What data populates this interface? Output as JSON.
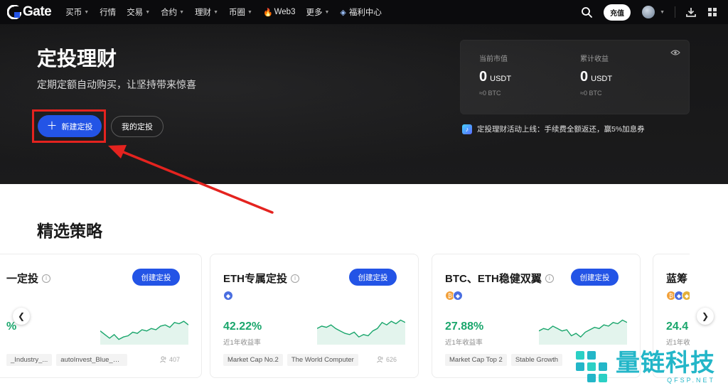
{
  "nav": {
    "logo_text": "Gate",
    "items": [
      {
        "label": "买币",
        "caret": true
      },
      {
        "label": "行情",
        "caret": false
      },
      {
        "label": "交易",
        "caret": true
      },
      {
        "label": "合约",
        "caret": true
      },
      {
        "label": "理财",
        "caret": true
      },
      {
        "label": "币圈",
        "caret": true
      },
      {
        "label": "Web3",
        "caret": false
      },
      {
        "label": "更多",
        "caret": true
      },
      {
        "label": "福利中心",
        "caret": false
      }
    ],
    "deposit_label": "充值"
  },
  "hero": {
    "title": "定投理财",
    "subtitle": "定期定额自动购买，让坚持带来惊喜",
    "new_plan_label": "新建定投",
    "my_plans_label": "我的定投",
    "assets": {
      "current_label": "当前市值",
      "current_value": "0",
      "current_unit": "USDT",
      "current_btc": "≈0 BTC",
      "profit_label": "累计收益",
      "profit_value": "0",
      "profit_unit": "USDT",
      "profit_btc": "≈0 BTC"
    },
    "promo": "定投理财活动上线：手续费全额返还，赢5%加息券"
  },
  "section": {
    "title": "精选策略",
    "create_label": "创建定投",
    "return_label": "近1年收益率",
    "cards": [
      {
        "title": "一定投",
        "coins": [],
        "pct": "%",
        "tags": [
          "_Industry_...",
          "autoInvest_Blue_C..."
        ],
        "users": "407",
        "spark": [
          0.55,
          0.7,
          0.85,
          0.7,
          0.9,
          0.8,
          0.75,
          0.6,
          0.65,
          0.5,
          0.55,
          0.45,
          0.5,
          0.35,
          0.3,
          0.4,
          0.2,
          0.25,
          0.15,
          0.3
        ]
      },
      {
        "title": "ETH专属定投",
        "coins": [
          "eth"
        ],
        "pct": "42.22%",
        "tags": [
          "Market Cap No.2",
          "The World Computer"
        ],
        "users": "626",
        "spark": [
          0.45,
          0.35,
          0.4,
          0.3,
          0.45,
          0.55,
          0.65,
          0.7,
          0.6,
          0.8,
          0.7,
          0.75,
          0.55,
          0.45,
          0.2,
          0.3,
          0.15,
          0.25,
          0.1,
          0.2
        ]
      },
      {
        "title": "BTC、ETH稳健双翼",
        "coins": [
          "btc",
          "eth"
        ],
        "pct": "27.88%",
        "tags": [
          "Market Cap Top 2",
          "Stable Growth"
        ],
        "users": "",
        "spark": [
          0.55,
          0.45,
          0.5,
          0.35,
          0.45,
          0.55,
          0.5,
          0.75,
          0.65,
          0.8,
          0.6,
          0.5,
          0.4,
          0.45,
          0.3,
          0.35,
          0.2,
          0.25,
          0.1,
          0.2
        ]
      },
      {
        "title": "蓝筹",
        "coins": [
          "btc",
          "eth",
          "bnb"
        ],
        "pct": "24.4",
        "tags": [],
        "users": "",
        "spark": []
      }
    ]
  },
  "icons": {
    "search": "search-icon",
    "download": "download-icon",
    "grid": "grid-icon",
    "eye": "eye-icon",
    "prev": "chevron-left-icon",
    "next": "chevron-right-icon"
  },
  "colors": {
    "accent": "#2354e6",
    "positive": "#1aa66c",
    "highlight": "#e4231f",
    "hero_bg": "#161617"
  },
  "watermark": {
    "cn": "量链科技",
    "en": "QFSP.NET"
  }
}
